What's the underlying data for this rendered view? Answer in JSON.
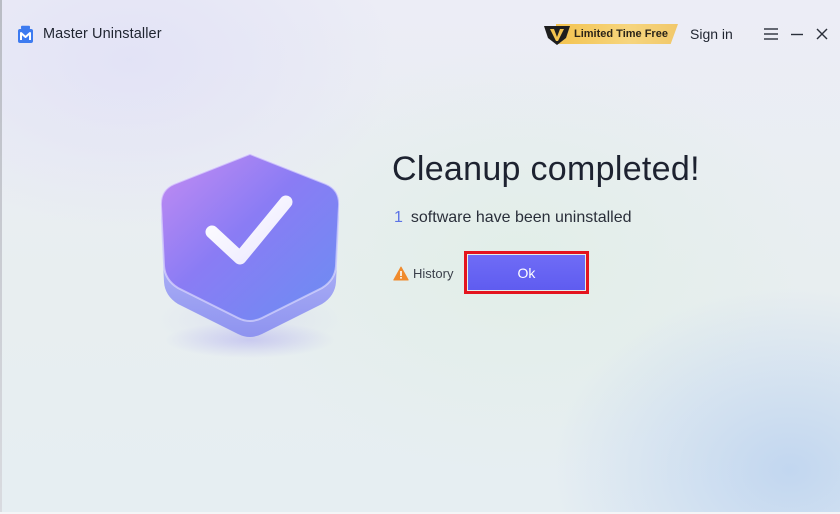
{
  "app": {
    "title": "Master Uninstaller",
    "logo_icon": "app-logo-icon"
  },
  "header": {
    "promo_label": "Limited Time Free",
    "promo_icon": "vip-v-badge-icon",
    "sign_in_label": "Sign in",
    "window_controls": [
      "menu-icon",
      "minimize-icon",
      "close-icon"
    ]
  },
  "result": {
    "title": "Cleanup completed!",
    "count": "1",
    "message": "software have been uninstalled",
    "hero_icon": "checkmark-shield-icon"
  },
  "actions": {
    "history_label": "History",
    "history_icon": "warning-icon",
    "ok_label": "Ok"
  },
  "colors": {
    "accent": "#5f5cf0",
    "count": "#5b73e6",
    "highlight_border": "#e4141e",
    "promo_gold": "#f3c34f"
  }
}
